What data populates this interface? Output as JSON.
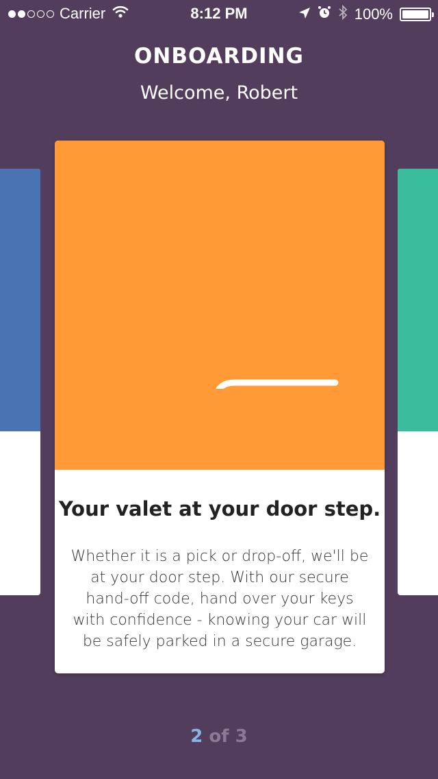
{
  "status_bar": {
    "carrier": "Carrier",
    "time": "8:12 PM",
    "battery": "100%",
    "icons": [
      "signal-dots",
      "wifi-icon",
      "location-icon",
      "alarm-icon",
      "bluetooth-icon",
      "battery-icon"
    ]
  },
  "header": {
    "title": "ONBOARDING",
    "subtitle": "Welcome, Robert"
  },
  "cards": {
    "left": {
      "color": "#4a73b3"
    },
    "current": {
      "color": "#ff9a36",
      "icon": "valet-hand-key-icon",
      "heading": "Your valet at your door step.",
      "body": "Whether it is a pick or drop-off, we'll be at your door step. With our secure hand-off code, hand over your keys with confidence - knowing your car will be safely parked in a secure garage."
    },
    "right": {
      "color": "#39bd9c"
    }
  },
  "pager": {
    "current": "2",
    "separator": "of",
    "total": "3"
  },
  "colors": {
    "background": "#523d5c",
    "pager_active": "#89b4e6"
  }
}
